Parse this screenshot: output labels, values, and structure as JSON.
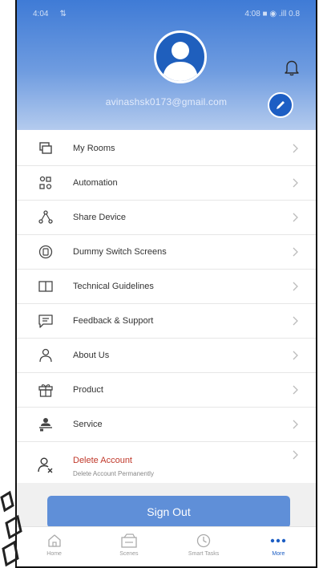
{
  "status_bar": {
    "time": "4:04",
    "carrier": "⇅",
    "right": "4:08 ■ ◉ .ill 0.8"
  },
  "header": {
    "email": "avinashsk0173@gmail.com",
    "bell_icon": "bell-icon",
    "edit_icon": "pencil-icon",
    "avatar_icon": "person-icon",
    "colors": {
      "top": "#3f7bd6",
      "bottom": "#b4cbee",
      "edit": "#1d5ec4"
    }
  },
  "menu": {
    "items": [
      {
        "label": "My Rooms",
        "icon": "rooms-icon"
      },
      {
        "label": "Automation",
        "icon": "automation-icon"
      },
      {
        "label": "Share Device",
        "icon": "share-icon"
      },
      {
        "label": "Dummy Switch Screens",
        "icon": "switch-icon"
      },
      {
        "label": "Technical Guidelines",
        "icon": "book-icon"
      },
      {
        "label": "Feedback & Support",
        "icon": "chat-icon"
      },
      {
        "label": "About Us",
        "icon": "person-icon"
      },
      {
        "label": "Product",
        "icon": "gift-icon"
      },
      {
        "label": "Service",
        "icon": "service-icon"
      }
    ],
    "delete": {
      "label": "Delete Account",
      "sublabel": "Delete Account Permanently",
      "icon": "user-remove-icon",
      "color": "#c0392b"
    }
  },
  "signout": {
    "label": "Sign Out",
    "color": "#5f8fd8"
  },
  "bottom_nav": [
    {
      "label": "Home",
      "icon": "home-icon"
    },
    {
      "label": "Scenes",
      "icon": "scenes-icon"
    },
    {
      "label": "Smart Tasks",
      "icon": "tasks-icon"
    },
    {
      "label": "More",
      "icon": "more-icon"
    }
  ]
}
